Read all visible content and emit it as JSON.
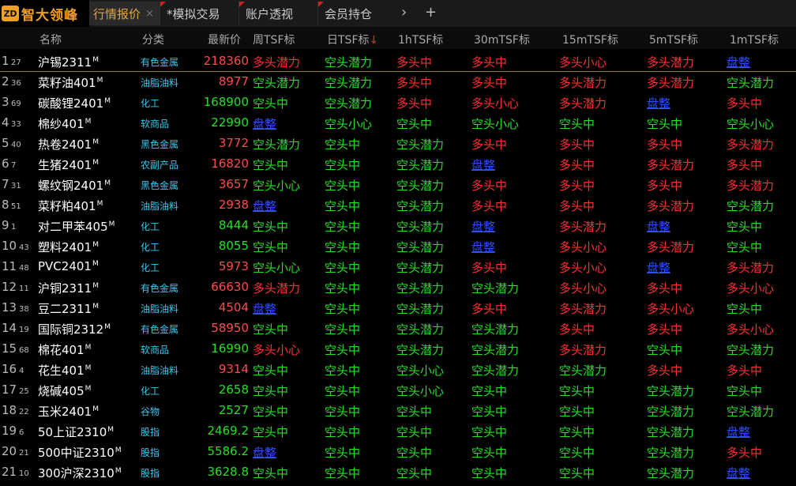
{
  "app": {
    "logo_badge": "ZD",
    "logo_text": "智大领峰"
  },
  "tabs": [
    {
      "label": "行情报价",
      "close": "×",
      "active": true
    },
    {
      "label": "*模拟交易",
      "close": "×"
    },
    {
      "label": "账户透视",
      "close": "×"
    },
    {
      "label": "会员持仓",
      "close": "×"
    }
  ],
  "tabnav": {
    "next": "›",
    "add": "+"
  },
  "columns": [
    "名称",
    "分类",
    "最新价",
    "周TSF标",
    "日TSF标",
    "1hTSF标",
    "30mTSF标",
    "15mTSF标",
    "5mTSF标",
    "1mTSF标"
  ],
  "sort_indicator": "↓",
  "colors": {
    "red": "#ff3030",
    "green": "#22e022",
    "blue": "#3050ff",
    "category": "#38c8f0",
    "accent": "#e8a33a"
  },
  "rows": [
    {
      "idx": "1",
      "sub": "27",
      "name": "沪锡2311",
      "m": "M",
      "cat": "有色金属",
      "price": "218360",
      "pc": "r",
      "s": [
        [
          "多头潜力",
          "r"
        ],
        [
          "空头潜力",
          "g"
        ],
        [
          "多头中",
          "r"
        ],
        [
          "多头中",
          "r"
        ],
        [
          "多头小心",
          "r"
        ],
        [
          "多头潜力",
          "r"
        ],
        [
          "盘整",
          "b"
        ]
      ]
    },
    {
      "idx": "2",
      "sub": "36",
      "name": "菜籽油401",
      "m": "M",
      "cat": "油脂油料",
      "price": "8977",
      "pc": "r",
      "s": [
        [
          "空头潜力",
          "g"
        ],
        [
          "空头潜力",
          "g"
        ],
        [
          "多头中",
          "r"
        ],
        [
          "多头中",
          "r"
        ],
        [
          "多头潜力",
          "r"
        ],
        [
          "多头潜力",
          "r"
        ],
        [
          "空头潜力",
          "g"
        ]
      ]
    },
    {
      "idx": "3",
      "sub": "69",
      "name": "碳酸锂2401",
      "m": "M",
      "cat": "化工",
      "price": "168900",
      "pc": "g",
      "s": [
        [
          "空头中",
          "g"
        ],
        [
          "空头潜力",
          "g"
        ],
        [
          "多头中",
          "r"
        ],
        [
          "多头小心",
          "r"
        ],
        [
          "多头潜力",
          "r"
        ],
        [
          "盘整",
          "b"
        ],
        [
          "多头中",
          "r"
        ]
      ]
    },
    {
      "idx": "4",
      "sub": "33",
      "name": "棉纱401",
      "m": "M",
      "cat": "软商品",
      "price": "22990",
      "pc": "g",
      "s": [
        [
          "盘整",
          "b"
        ],
        [
          "空头小心",
          "g"
        ],
        [
          "空头中",
          "g"
        ],
        [
          "空头小心",
          "g"
        ],
        [
          "空头中",
          "g"
        ],
        [
          "空头中",
          "g"
        ],
        [
          "空头小心",
          "g"
        ]
      ]
    },
    {
      "idx": "5",
      "sub": "40",
      "name": "热卷2401",
      "m": "M",
      "cat": "黑色金属",
      "price": "3772",
      "pc": "r",
      "s": [
        [
          "空头潜力",
          "g"
        ],
        [
          "空头中",
          "g"
        ],
        [
          "空头潜力",
          "g"
        ],
        [
          "多头中",
          "r"
        ],
        [
          "多头中",
          "r"
        ],
        [
          "多头中",
          "r"
        ],
        [
          "多头潜力",
          "r"
        ]
      ]
    },
    {
      "idx": "6",
      "sub": "7",
      "name": "生猪2401",
      "m": "M",
      "cat": "农副产品",
      "price": "16820",
      "pc": "r",
      "s": [
        [
          "空头中",
          "g"
        ],
        [
          "空头中",
          "g"
        ],
        [
          "空头潜力",
          "g"
        ],
        [
          "盘整",
          "b"
        ],
        [
          "多头中",
          "r"
        ],
        [
          "多头潜力",
          "r"
        ],
        [
          "多头中",
          "r"
        ]
      ]
    },
    {
      "idx": "7",
      "sub": "31",
      "name": "螺纹钢2401",
      "m": "M",
      "cat": "黑色金属",
      "price": "3657",
      "pc": "r",
      "s": [
        [
          "空头小心",
          "g"
        ],
        [
          "空头中",
          "g"
        ],
        [
          "空头潜力",
          "g"
        ],
        [
          "多头中",
          "r"
        ],
        [
          "多头中",
          "r"
        ],
        [
          "多头中",
          "r"
        ],
        [
          "多头潜力",
          "r"
        ]
      ]
    },
    {
      "idx": "8",
      "sub": "51",
      "name": "菜籽粕401",
      "m": "M",
      "cat": "油脂油料",
      "price": "2938",
      "pc": "r",
      "s": [
        [
          "盘整",
          "b"
        ],
        [
          "空头中",
          "g"
        ],
        [
          "空头潜力",
          "g"
        ],
        [
          "多头中",
          "r"
        ],
        [
          "多头中",
          "r"
        ],
        [
          "多头潜力",
          "r"
        ],
        [
          "空头潜力",
          "g"
        ]
      ]
    },
    {
      "idx": "9",
      "sub": "1",
      "name": "对二甲苯405",
      "m": "M",
      "cat": "化工",
      "price": "8444",
      "pc": "g",
      "s": [
        [
          "空头中",
          "g"
        ],
        [
          "空头中",
          "g"
        ],
        [
          "空头潜力",
          "g"
        ],
        [
          "盘整",
          "b"
        ],
        [
          "多头潜力",
          "r"
        ],
        [
          "盘整",
          "b"
        ],
        [
          "空头中",
          "g"
        ]
      ]
    },
    {
      "idx": "10",
      "sub": "43",
      "name": "塑料2401",
      "m": "M",
      "cat": "化工",
      "price": "8055",
      "pc": "g",
      "s": [
        [
          "空头中",
          "g"
        ],
        [
          "空头中",
          "g"
        ],
        [
          "空头潜力",
          "g"
        ],
        [
          "盘整",
          "b"
        ],
        [
          "多头小心",
          "r"
        ],
        [
          "多头潜力",
          "r"
        ],
        [
          "空头中",
          "g"
        ]
      ]
    },
    {
      "idx": "11",
      "sub": "48",
      "name": "PVC2401",
      "m": "M",
      "cat": "化工",
      "price": "5973",
      "pc": "r",
      "s": [
        [
          "空头小心",
          "g"
        ],
        [
          "空头中",
          "g"
        ],
        [
          "空头潜力",
          "g"
        ],
        [
          "多头中",
          "r"
        ],
        [
          "多头小心",
          "r"
        ],
        [
          "盘整",
          "b"
        ],
        [
          "多头潜力",
          "r"
        ]
      ]
    },
    {
      "idx": "12",
      "sub": "11",
      "name": "沪铜2311",
      "m": "M",
      "cat": "有色金属",
      "price": "66630",
      "pc": "r",
      "s": [
        [
          "多头潜力",
          "r"
        ],
        [
          "空头中",
          "g"
        ],
        [
          "空头潜力",
          "g"
        ],
        [
          "空头潜力",
          "g"
        ],
        [
          "多头小心",
          "r"
        ],
        [
          "多头中",
          "r"
        ],
        [
          "多头小心",
          "r"
        ]
      ]
    },
    {
      "idx": "13",
      "sub": "38",
      "name": "豆二2311",
      "m": "M",
      "cat": "油脂油料",
      "price": "4504",
      "pc": "r",
      "s": [
        [
          "盘整",
          "b"
        ],
        [
          "空头中",
          "g"
        ],
        [
          "空头潜力",
          "g"
        ],
        [
          "多头中",
          "r"
        ],
        [
          "多头潜力",
          "r"
        ],
        [
          "多头小心",
          "r"
        ],
        [
          "空头中",
          "g"
        ]
      ]
    },
    {
      "idx": "14",
      "sub": "19",
      "name": "国际铜2312",
      "m": "M",
      "cat": "有色金属",
      "price": "58950",
      "pc": "r",
      "s": [
        [
          "空头中",
          "g"
        ],
        [
          "空头中",
          "g"
        ],
        [
          "空头潜力",
          "g"
        ],
        [
          "空头潜力",
          "g"
        ],
        [
          "多头中",
          "r"
        ],
        [
          "多头中",
          "r"
        ],
        [
          "多头小心",
          "r"
        ]
      ]
    },
    {
      "idx": "15",
      "sub": "68",
      "name": "棉花401",
      "m": "M",
      "cat": "软商品",
      "price": "16990",
      "pc": "g",
      "s": [
        [
          "多头小心",
          "r"
        ],
        [
          "空头中",
          "g"
        ],
        [
          "空头潜力",
          "g"
        ],
        [
          "空头潜力",
          "g"
        ],
        [
          "多头潜力",
          "r"
        ],
        [
          "空头中",
          "g"
        ],
        [
          "空头潜力",
          "g"
        ]
      ]
    },
    {
      "idx": "16",
      "sub": "4",
      "name": "花生401",
      "m": "M",
      "cat": "油脂油料",
      "price": "9314",
      "pc": "r",
      "s": [
        [
          "空头中",
          "g"
        ],
        [
          "空头中",
          "g"
        ],
        [
          "空头小心",
          "g"
        ],
        [
          "空头潜力",
          "g"
        ],
        [
          "空头潜力",
          "g"
        ],
        [
          "多头中",
          "r"
        ],
        [
          "多头中",
          "r"
        ]
      ]
    },
    {
      "idx": "17",
      "sub": "25",
      "name": "烧碱405",
      "m": "M",
      "cat": "化工",
      "price": "2658",
      "pc": "g",
      "s": [
        [
          "空头中",
          "g"
        ],
        [
          "空头中",
          "g"
        ],
        [
          "空头小心",
          "g"
        ],
        [
          "空头中",
          "g"
        ],
        [
          "空头中",
          "g"
        ],
        [
          "空头潜力",
          "g"
        ],
        [
          "空头中",
          "g"
        ]
      ]
    },
    {
      "idx": "18",
      "sub": "22",
      "name": "玉米2401",
      "m": "M",
      "cat": "谷物",
      "price": "2527",
      "pc": "g",
      "s": [
        [
          "空头中",
          "g"
        ],
        [
          "空头中",
          "g"
        ],
        [
          "空头中",
          "g"
        ],
        [
          "空头中",
          "g"
        ],
        [
          "空头中",
          "g"
        ],
        [
          "空头潜力",
          "g"
        ],
        [
          "空头潜力",
          "g"
        ]
      ]
    },
    {
      "idx": "19",
      "sub": "6",
      "name": "50上证2310",
      "m": "M",
      "cat": "股指",
      "price": "2469.2",
      "pc": "g",
      "s": [
        [
          "空头中",
          "g"
        ],
        [
          "空头中",
          "g"
        ],
        [
          "空头中",
          "g"
        ],
        [
          "空头中",
          "g"
        ],
        [
          "空头中",
          "g"
        ],
        [
          "空头潜力",
          "g"
        ],
        [
          "盘整",
          "b"
        ]
      ]
    },
    {
      "idx": "20",
      "sub": "21",
      "name": "500中证2310",
      "m": "M",
      "cat": "股指",
      "price": "5586.2",
      "pc": "g",
      "s": [
        [
          "盘整",
          "b"
        ],
        [
          "空头中",
          "g"
        ],
        [
          "空头中",
          "g"
        ],
        [
          "空头中",
          "g"
        ],
        [
          "空头中",
          "g"
        ],
        [
          "空头潜力",
          "g"
        ],
        [
          "多头中",
          "r"
        ]
      ]
    },
    {
      "idx": "21",
      "sub": "10",
      "name": "300沪深2310",
      "m": "M",
      "cat": "股指",
      "price": "3628.8",
      "pc": "g",
      "s": [
        [
          "空头中",
          "g"
        ],
        [
          "空头中",
          "g"
        ],
        [
          "空头中",
          "g"
        ],
        [
          "空头中",
          "g"
        ],
        [
          "空头中",
          "g"
        ],
        [
          "空头潜力",
          "g"
        ],
        [
          "盘整",
          "b"
        ]
      ]
    }
  ]
}
